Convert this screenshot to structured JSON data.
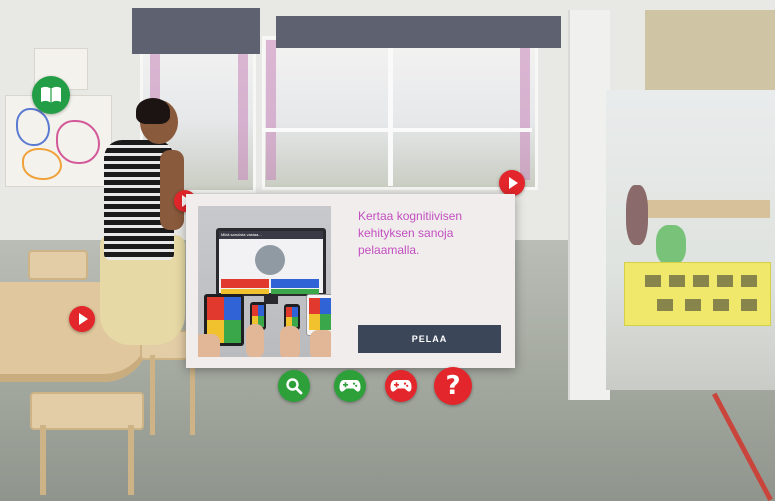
{
  "viewer": {
    "info_text": "Kertaa kognitiivisen kehityksen sanoja pelaamalla.",
    "play_button_label": "PELAA",
    "preview_question": "Mikä sanoista vastaa..."
  },
  "toolbar": {
    "items": [
      {
        "icon": "search-icon",
        "color": "#2da03a"
      },
      {
        "icon": "gamepad-icon",
        "color": "#2da03a"
      },
      {
        "icon": "gamepad-icon",
        "color": "#e3262b"
      },
      {
        "icon": "help-icon",
        "label": "?",
        "color": "#e3262b"
      }
    ]
  },
  "book_button": {
    "icon": "book-icon",
    "color": "#239d46"
  },
  "hotspots": [
    {
      "icon": "play-icon",
      "color": "#e3262b"
    },
    {
      "icon": "play-icon",
      "color": "#e3262b"
    },
    {
      "icon": "play-icon",
      "color": "#e3262b"
    }
  ],
  "colors": {
    "accent_text": "#c24fc0",
    "button_bg": "#3c4659",
    "card_bg": "#f1eded"
  }
}
